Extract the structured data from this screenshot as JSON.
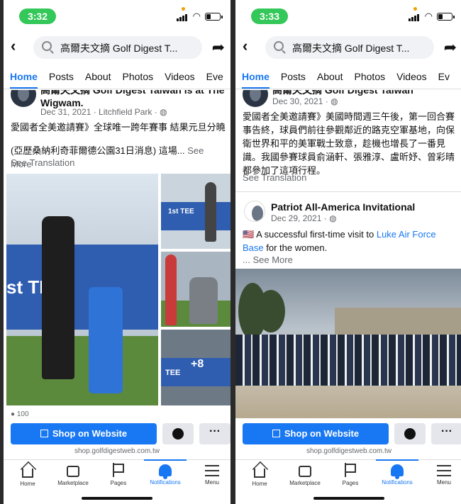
{
  "left": {
    "status": {
      "time": "3:32"
    },
    "search": {
      "query": "高爾夫文摘 Golf Digest T..."
    },
    "tabs": [
      "Home",
      "Posts",
      "About",
      "Photos",
      "Videos",
      "Eve"
    ],
    "post": {
      "author_line": "高爾夫文摘 Golf Digest Taiwan is at The",
      "author_line2": "Wigwam.",
      "meta": "Dec 31, 2021 · Litchfield Park · ",
      "text1": "愛國者全美邀請賽》全球唯一跨年賽事  結果元旦分曉",
      "text2": "(亞歷桑納利奇菲爾德公園31日消息) 這場...",
      "see_more": " See More",
      "see_translation": "See Translation",
      "banner_text": "st TE",
      "thumb_banner": "1st TEE",
      "more_photos": "+8",
      "thumb_tee": "TEE",
      "reactions": "100"
    },
    "shop": {
      "label": "Shop on Website",
      "url": "shop.golfdigestweb.com.tw",
      "more": "···"
    },
    "nav": [
      {
        "name": "home",
        "label": "Home"
      },
      {
        "name": "marketplace",
        "label": "Marketplace"
      },
      {
        "name": "pages",
        "label": "Pages"
      },
      {
        "name": "notifications",
        "label": "Notifications"
      },
      {
        "name": "menu",
        "label": "Menu"
      }
    ]
  },
  "right": {
    "status": {
      "time": "3:33"
    },
    "search": {
      "query": "高爾夫文摘 Golf Digest T..."
    },
    "tabs": [
      "Home",
      "Posts",
      "About",
      "Photos",
      "Videos",
      "Ev"
    ],
    "post": {
      "author_line": "高爾夫文摘 Golf Digest Taiwan",
      "meta": "Dec 30, 2021 · ",
      "text_lines": [
        "愛國者全美邀請賽》美國時間週三午後，第一回合賽",
        "事告終，球員們前往參觀鄰近的路克空軍基地，向保",
        "衛世界和平的美軍戰士致意，趁機也增長了一番見",
        "識。我國參賽球員俞涵軒、張雅淳、盧昕妤、曾彩晴",
        "都參加了這項行程。"
      ],
      "see_translation": "See Translation",
      "shared": {
        "name": "Patriot All-America Invitational",
        "meta": "Dec 29, 2021 · ",
        "text_pre": "🇺🇸 A successful first-time visit to ",
        "text_link1": "Luke Air Force",
        "text_link2": "Base",
        "text_post": " for the women.",
        "see_more": "... See More"
      }
    },
    "shop": {
      "label": "Shop on Website",
      "url": "shop.golfdigestweb.com.tw",
      "more": "···"
    },
    "nav": [
      {
        "name": "home",
        "label": "Home"
      },
      {
        "name": "marketplace",
        "label": "Marketplace"
      },
      {
        "name": "pages",
        "label": "Pages"
      },
      {
        "name": "notifications",
        "label": "Notifications"
      },
      {
        "name": "menu",
        "label": "Menu"
      }
    ]
  }
}
